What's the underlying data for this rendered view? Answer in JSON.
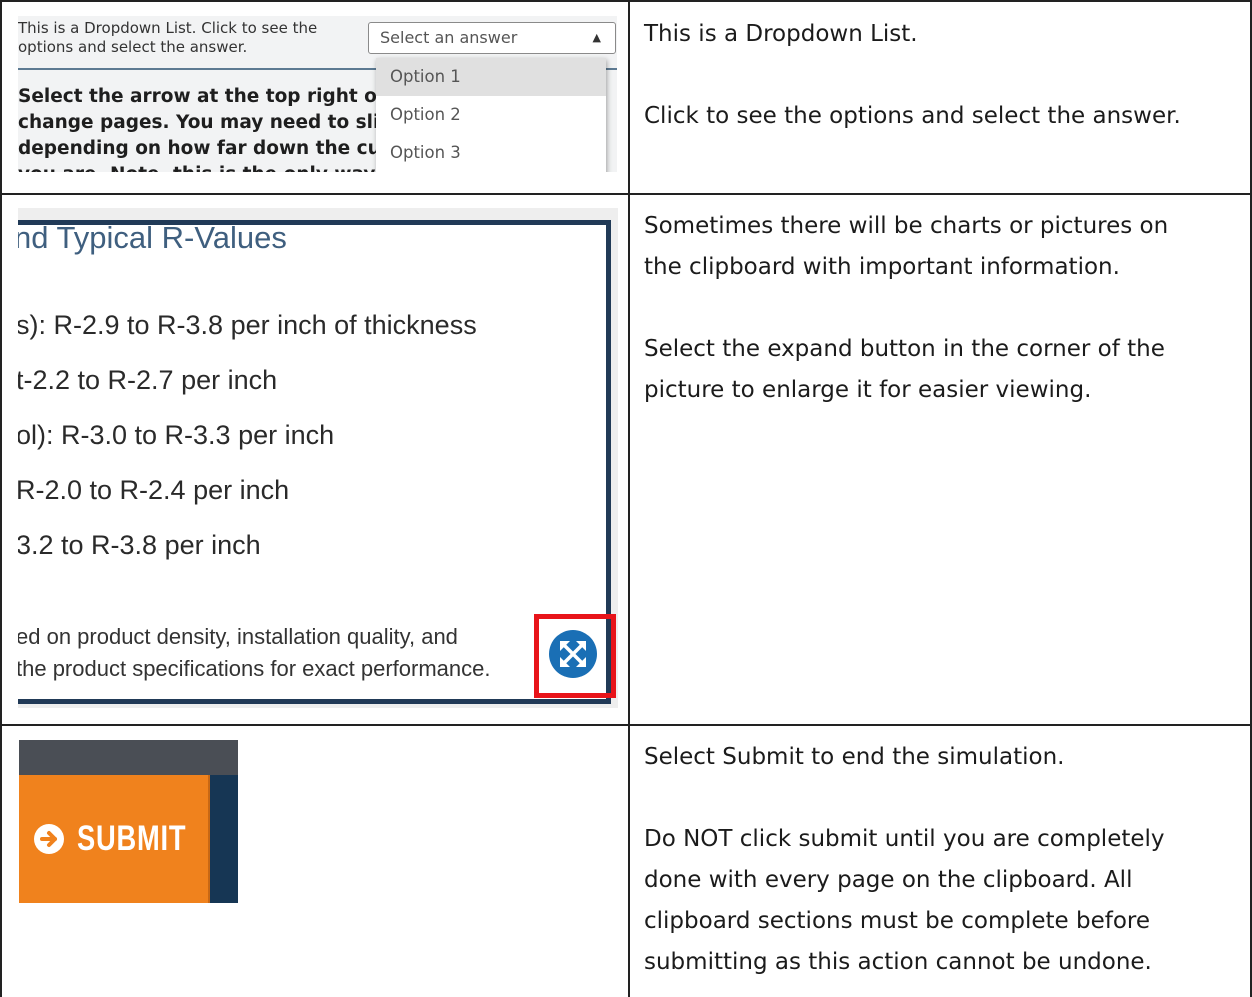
{
  "rows": [
    {
      "description": [
        "This is a Dropdown List.",
        "Click to see the options and select the answer."
      ],
      "screenshot": {
        "instruction_lines": [
          "This is a Dropdown List. Click to see the",
          "options and select the answer."
        ],
        "select_placeholder": "Select an answer",
        "options": [
          "Option 1",
          "Option 2",
          "Option 3"
        ],
        "body_lines": [
          "Select the arrow at the top right of",
          "change pages. You may need to sli",
          "depending on how far down the cu",
          "you are. Note, this is the only way t"
        ]
      }
    },
    {
      "description": [
        "Sometimes there will be charts or pictures on",
        "the clipboard with important information.",
        "Select the expand button in the corner of the",
        "picture to enlarge it for easier viewing."
      ],
      "screenshot": {
        "heading": "nd Typical R-Values",
        "lines": [
          "s): R-2.9 to R-3.8 per inch of thickness",
          "t-2.2 to R-2.7 per inch",
          "ol): R-3.0 to R-3.3 per inch",
          "R-2.0 to R-2.4 per inch",
          "3.2 to R-3.8 per inch"
        ],
        "footer_lines": [
          "ed on product density, installation quality, and",
          "the product specifications for exact performance."
        ],
        "highlight_color": "#e8141a",
        "button_color": "#1a6fb5"
      }
    },
    {
      "description": [
        "Select Submit to end the simulation.",
        "Do NOT click submit until you are completely",
        "done with every page on the clipboard. All",
        "clipboard sections must be complete before",
        "submitting as this action cannot be undone."
      ],
      "screenshot": {
        "button_label": "SUBMIT",
        "button_color": "#f0821d"
      }
    }
  ]
}
